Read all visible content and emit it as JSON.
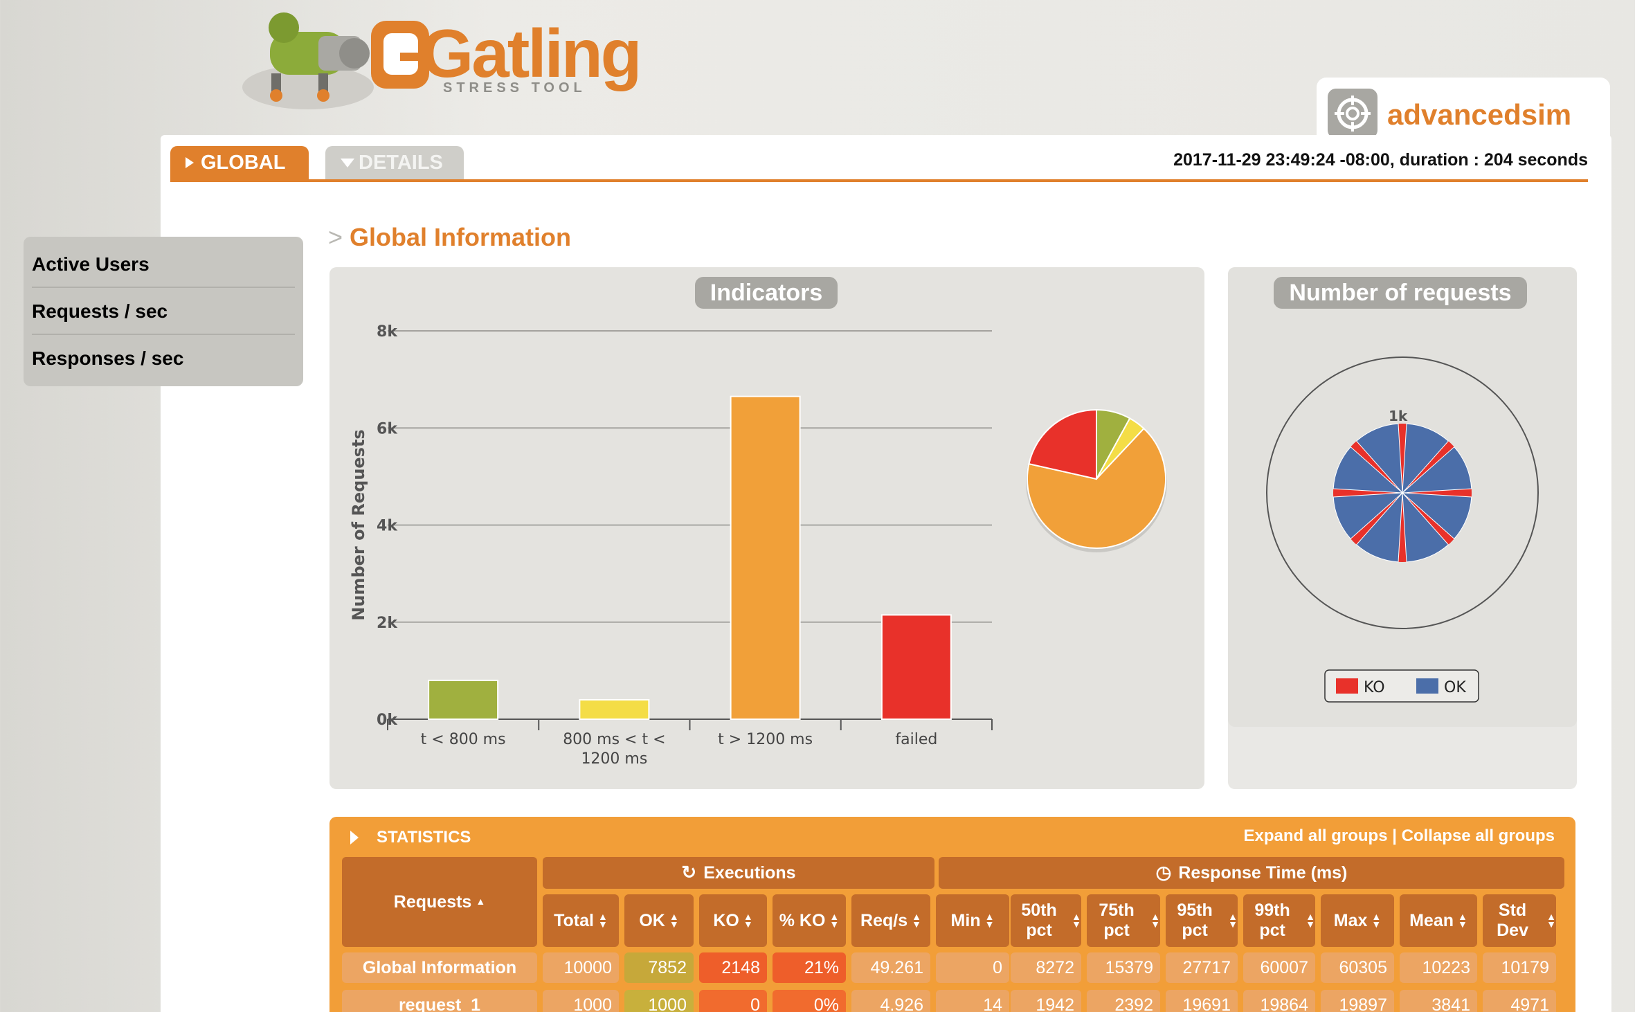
{
  "app": {
    "logo_text": "Gatling",
    "logo_subtitle": "STRESS TOOL"
  },
  "simulation": {
    "name": "advancedsim",
    "run_info": "2017-11-29 23:49:24 -08:00, duration : 204 seconds"
  },
  "tabs": {
    "global": "GLOBAL",
    "details": "DETAILS"
  },
  "sidebar": {
    "items": [
      {
        "label": "Active Users"
      },
      {
        "label": "Requests / sec"
      },
      {
        "label": "Responses / sec"
      }
    ]
  },
  "section": {
    "prefix": ">",
    "title": "Global Information"
  },
  "colors": {
    "accent": "#e0802c",
    "green": "#a0b03f",
    "yellow": "#f4dd46",
    "orange": "#f1a039",
    "red": "#e8312a",
    "blue": "#4b6ea9"
  },
  "chart_data": [
    {
      "type": "bar",
      "title": "Indicators",
      "ylabel": "Number of Requests",
      "xlabel": "",
      "ylim": [
        0,
        8000
      ],
      "yticks": [
        0,
        2000,
        4000,
        6000,
        8000
      ],
      "ytick_labels": [
        "0k",
        "2k",
        "4k",
        "6k",
        "8k"
      ],
      "categories": [
        "t < 800 ms",
        "800 ms < t < 1200 ms",
        "t > 1200 ms",
        "failed"
      ],
      "category_label_lines": [
        [
          "t < 800 ms"
        ],
        [
          "800 ms < t <",
          "1200 ms"
        ],
        [
          "t > 1200 ms"
        ],
        [
          "failed"
        ]
      ],
      "values": [
        800,
        400,
        6650,
        2148
      ],
      "colors": [
        "#a0b03f",
        "#f4dd46",
        "#f1a039",
        "#e8312a"
      ],
      "grid": true
    },
    {
      "type": "pie",
      "title": "",
      "values": [
        800,
        400,
        6650,
        2148
      ],
      "colors": [
        "#a0b03f",
        "#f4dd46",
        "#f1a039",
        "#e8312a"
      ]
    },
    {
      "type": "pie",
      "title": "Number of requests",
      "radial_label": "1k",
      "legend": [
        {
          "name": "KO",
          "color": "#e8312a"
        },
        {
          "name": "OK",
          "color": "#4b6ea9"
        }
      ],
      "legend_position": "bottom",
      "series": [
        {
          "name": "OK",
          "values": [
            1000,
            1000,
            1000,
            1000,
            1000,
            1000,
            1000,
            1000
          ]
        },
        {
          "name": "KO",
          "values": [
            0,
            0,
            0,
            0,
            0,
            0,
            0,
            0
          ]
        }
      ]
    }
  ],
  "statistics": {
    "title": "STATISTICS",
    "expand_all": "Expand all groups",
    "separator": "|",
    "collapse_all": "Collapse all groups",
    "group_requests": "Requests",
    "group_executions": "Executions",
    "group_response_time": "Response Time (ms)",
    "columns": [
      "Total",
      "OK",
      "KO",
      "% KO",
      "Req/s",
      "Min",
      "50th pct",
      "75th pct",
      "95th pct",
      "99th pct",
      "Max",
      "Mean",
      "Std Dev"
    ],
    "rows": [
      {
        "name": "Global Information",
        "values": [
          "10000",
          "7852",
          "2148",
          "21%",
          "49.261",
          "0",
          "8272",
          "15379",
          "27717",
          "60007",
          "60305",
          "10223",
          "10179"
        ]
      },
      {
        "name": "request_1",
        "values": [
          "1000",
          "1000",
          "0",
          "0%",
          "4.926",
          "14",
          "1942",
          "2392",
          "19691",
          "19864",
          "19897",
          "3841",
          "4971"
        ]
      }
    ]
  }
}
